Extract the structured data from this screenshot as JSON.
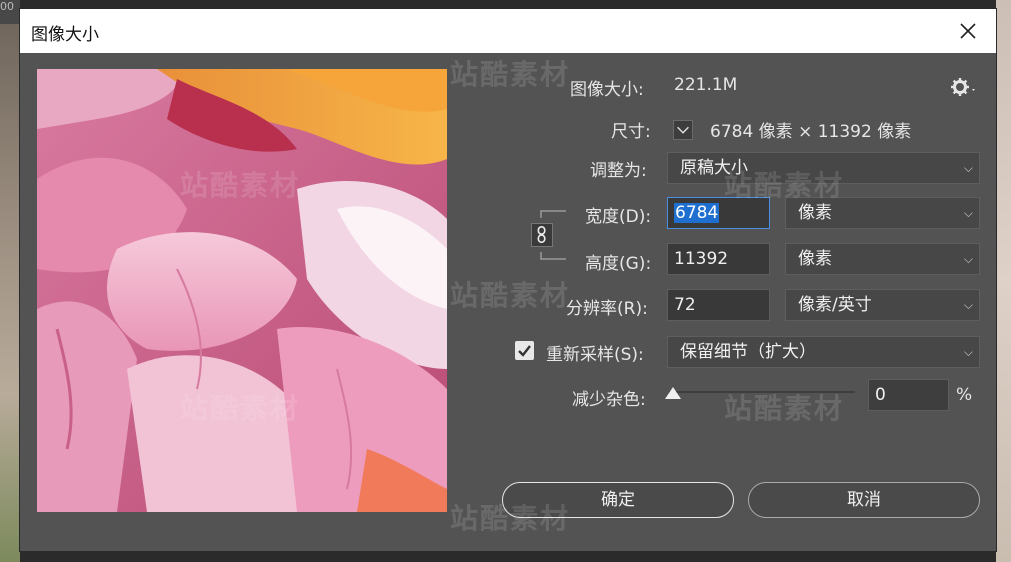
{
  "background": {
    "tab_text": "00"
  },
  "dialog": {
    "title": "图像大小",
    "image_size_label": "图像大小:",
    "image_size_value": "221.1M",
    "gear_icon": "gear-icon",
    "dimensions_label": "尺寸:",
    "dimensions_value": "6784 像素  ×  11392 像素",
    "fit_to_label": "调整为:",
    "fit_to_value": "原稿大小",
    "width_label": "宽度(D):",
    "width_value": "6784",
    "width_unit": "像素",
    "height_label": "高度(G):",
    "height_value": "11392",
    "height_unit": "像素",
    "resolution_label": "分辨率(R):",
    "resolution_value": "72",
    "resolution_unit": "像素/英寸",
    "resample_label": "重新采样(S):",
    "resample_checked": true,
    "resample_value": "保留细节（扩大）",
    "noise_label": "减少杂色:",
    "noise_value": "0",
    "noise_level": 0,
    "noise_unit": "%",
    "ok_label": "确定",
    "cancel_label": "取消"
  },
  "watermark_text": "站酷素材",
  "colors": {
    "dialog_bg": "#535353",
    "selection": "#1f6fd1",
    "focus_border": "#4a8fe0"
  }
}
